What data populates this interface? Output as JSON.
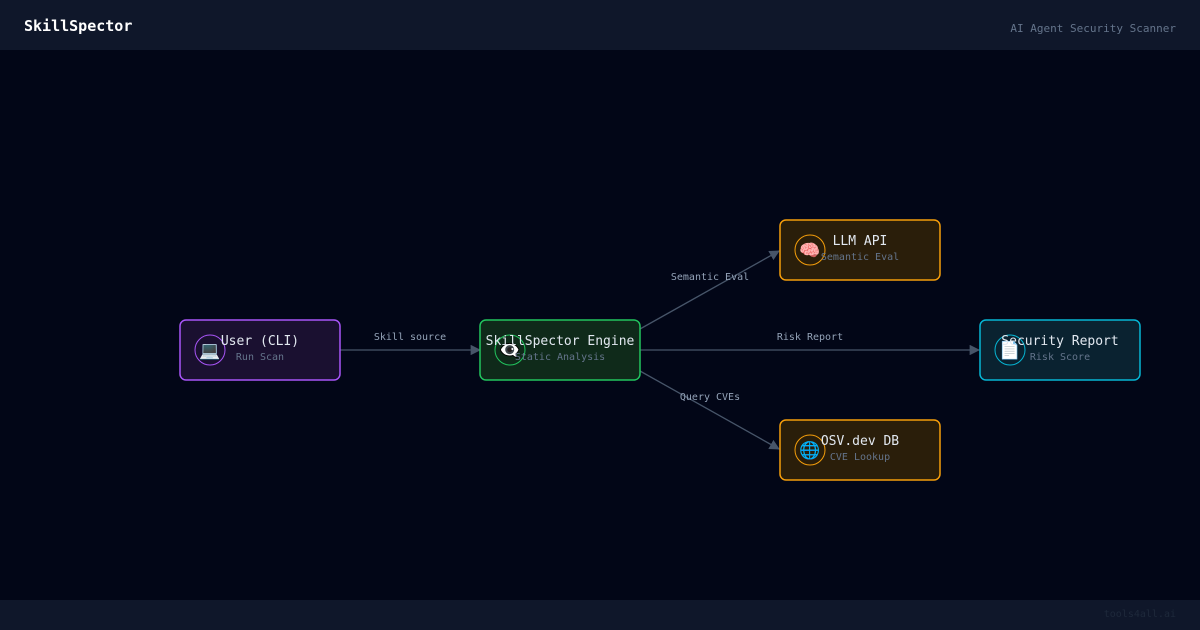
{
  "header": {
    "brand": "SkillSpector",
    "tagline": "AI Agent Security Scanner"
  },
  "footer": {
    "credit": "tools4all.ai"
  },
  "nodes": {
    "user": {
      "title": "User (CLI)",
      "subtitle": "Run Scan",
      "icon": "💻",
      "icon_name": "laptop-icon",
      "color": "#a855f7",
      "fill": "#1a1030"
    },
    "engine": {
      "title": "SkillSpector Engine",
      "subtitle": "Static Analysis",
      "icon": "👁️‍🗨️",
      "icon_name": "eye-icon",
      "color": "#22c55e",
      "fill": "#0f2a1a"
    },
    "llm": {
      "title": "LLM API",
      "subtitle": "Semantic Eval",
      "icon": "🧠",
      "icon_name": "brain-icon",
      "color": "#f59e0b",
      "fill": "#2a1e0a"
    },
    "osv": {
      "title": "OSV.dev DB",
      "subtitle": "CVE Lookup",
      "icon": "🌐",
      "icon_name": "globe-icon",
      "color": "#f59e0b",
      "fill": "#2a1e0a"
    },
    "report": {
      "title": "Security Report",
      "subtitle": "Risk Score",
      "icon": "📄",
      "icon_name": "document-icon",
      "color": "#06b6d4",
      "fill": "#0a2230"
    }
  },
  "edges": {
    "skill_source": "Skill source",
    "semantic_eval": "Semantic Eval",
    "risk_report": "Risk Report",
    "query_cves": "Query CVEs"
  }
}
